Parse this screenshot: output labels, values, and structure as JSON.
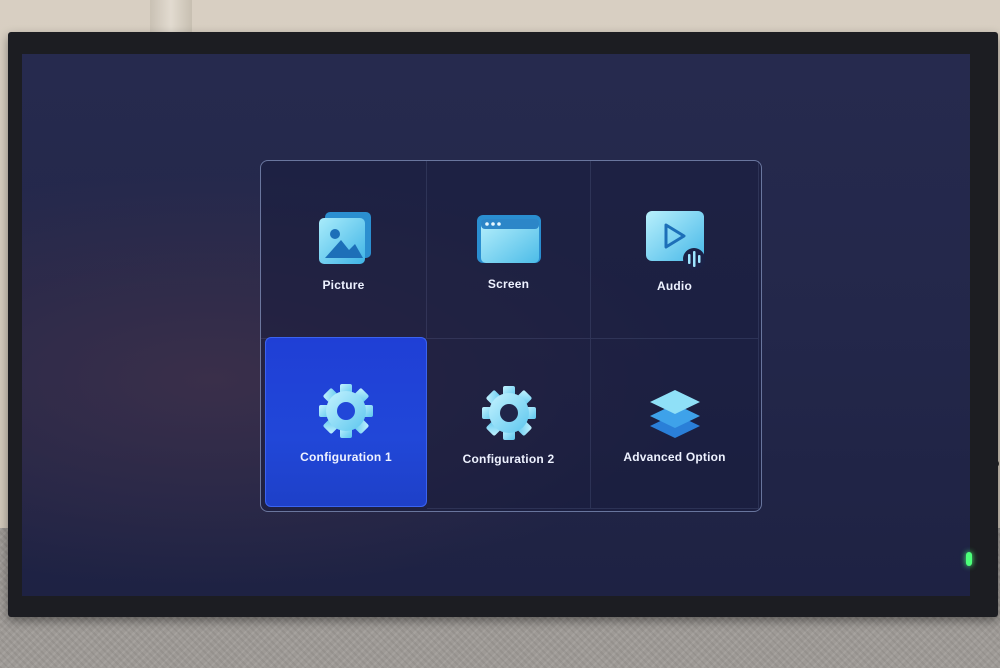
{
  "menu": {
    "tiles": [
      {
        "label": "Picture",
        "icon": "picture-icon"
      },
      {
        "label": "Screen",
        "icon": "screen-icon"
      },
      {
        "label": "Audio",
        "icon": "audio-icon"
      },
      {
        "label": "Configuration 1",
        "icon": "gear-icon",
        "selected": true
      },
      {
        "label": "Configuration 2",
        "icon": "gear-icon"
      },
      {
        "label": "Advanced Option",
        "icon": "layers-icon"
      }
    ]
  },
  "colors": {
    "screen_bg": "#23274a",
    "selected_tile": "#2147d8",
    "icon_cyan": "#6fd8f0",
    "panel_border": "#aabeeb",
    "power_led": "#4cff7a"
  }
}
